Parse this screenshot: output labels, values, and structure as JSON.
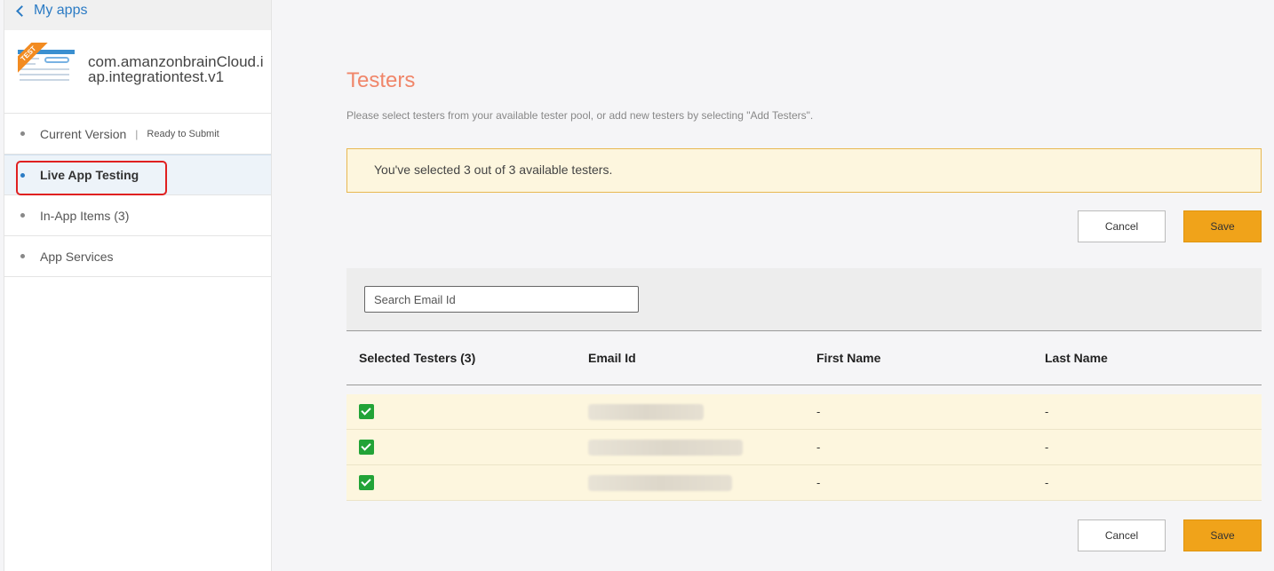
{
  "sidebar": {
    "back_label": "My apps",
    "app_icon_badge": "TEST",
    "app_name": "com.amanzonbrainCloud.iap.integrationtest.v1",
    "items": [
      {
        "label": "Current Version",
        "status": "Ready to Submit"
      },
      {
        "label": "Live App Testing"
      },
      {
        "label": "In-App Items (3)"
      },
      {
        "label": "App Services"
      }
    ]
  },
  "main": {
    "title": "Testers",
    "subtitle": "Please select testers from your available tester pool, or add new testers by selecting \"Add Testers\".",
    "alert": "You've selected 3 out of 3 available testers.",
    "cancel_label": "Cancel",
    "save_label": "Save",
    "search_placeholder": "Search Email Id",
    "columns": [
      "Selected Testers (3)",
      "Email Id",
      "First Name",
      "Last Name"
    ],
    "rows": [
      {
        "selected": true,
        "email": "",
        "first_name": "-",
        "last_name": "-"
      },
      {
        "selected": true,
        "email": "",
        "first_name": "-",
        "last_name": "-"
      },
      {
        "selected": true,
        "email": "",
        "first_name": "-",
        "last_name": "-"
      }
    ]
  },
  "colors": {
    "accent": "#2b7bc4",
    "title": "#f0866a",
    "save": "#f0a31a",
    "alert_bg": "#fdf6de",
    "check": "#22a337"
  }
}
